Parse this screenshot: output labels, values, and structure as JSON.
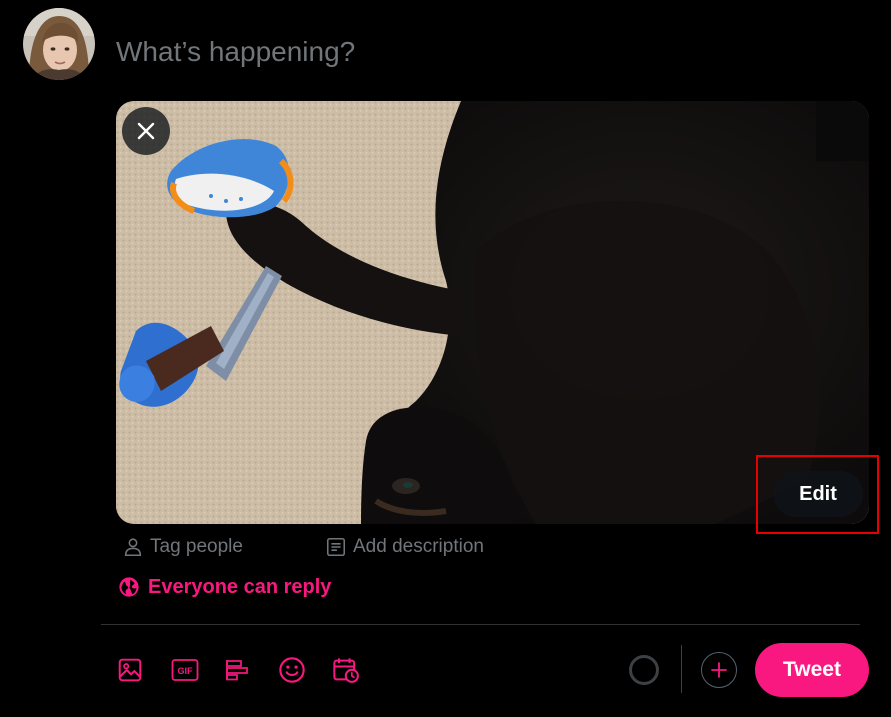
{
  "composer": {
    "placeholder": "What’s happening?",
    "value": ""
  },
  "media": {
    "remove_icon": "close-icon",
    "edit_label": "Edit"
  },
  "media_actions": {
    "tag_people": "Tag people",
    "add_description": "Add description"
  },
  "reply_setting": {
    "label": "Everyone can reply",
    "icon": "globe-icon"
  },
  "toolbar": {
    "icons": [
      "media-icon",
      "gif-icon",
      "poll-icon",
      "emoji-icon",
      "schedule-icon"
    ],
    "gif_text": "GIF",
    "add_icon": "plus-icon",
    "tweet_label": "Tweet"
  },
  "colors": {
    "accent": "#f91880",
    "background": "#000000",
    "muted_text": "#71767b",
    "divider": "#2f3336",
    "highlight": "#e60000"
  }
}
